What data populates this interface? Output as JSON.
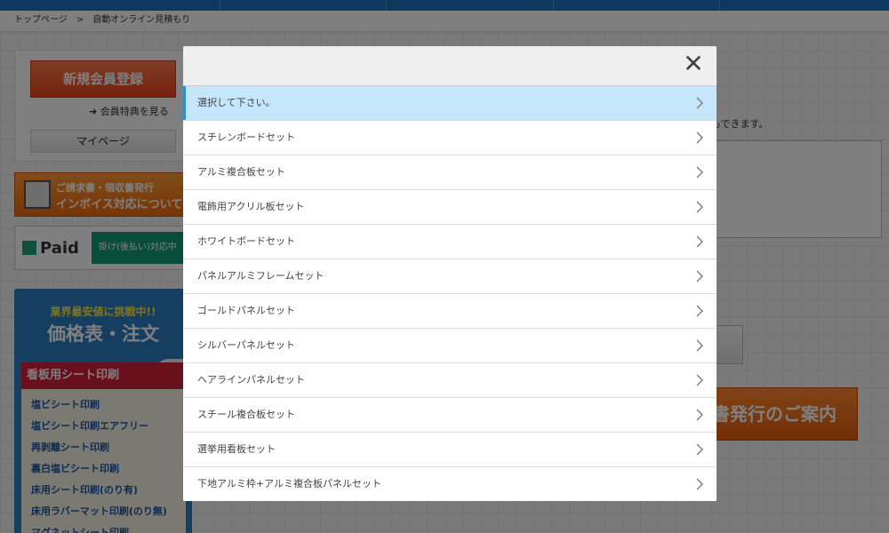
{
  "breadcrumb": {
    "home": "トップページ",
    "separator": ">",
    "current": "自動オンライン見積もり"
  },
  "sidebar": {
    "register_button": "新規会員登録",
    "benefit_link": "会員特典を見る",
    "mypage_button": "マイページ",
    "invoice_banner": {
      "line1": "ご請求書・領収書発行",
      "line2": "インボイス対応について"
    },
    "paid_banner": {
      "logo": "Paid",
      "tag": "掛け(後払い)対応中"
    },
    "price_panel": {
      "subtitle": "業界最安値に挑戦中!!",
      "title": "価格表・注文",
      "category": "看板用シート印刷",
      "items": [
        "塩ビシート印刷",
        "塩ビシート印刷エアフリー",
        "再剥離シート印刷",
        "裏白塩ビシート印刷",
        "床用シート印刷(のり有)",
        "床用ラバーマット印刷(のり無)",
        "マグネットシート印刷"
      ]
    }
  },
  "main": {
    "note_fragment": "もできます。",
    "banner_fragment": "書発行のご案内"
  },
  "modal": {
    "close_label": "✕",
    "options": [
      "選択して下さい。",
      "スチレンボードセット",
      "アルミ複合板セット",
      "電飾用アクリル板セット",
      "ホワイトボードセット",
      "パネルアルミフレームセット",
      "ゴールドパネルセット",
      "シルバーパネルセット",
      "ヘアラインパネルセット",
      "スチール複合板セット",
      "選挙用看板セット",
      "下地アルミ枠+アルミ複合板パネルセット"
    ],
    "selected_index": 0
  },
  "colors": {
    "accent_blue": "#2a8fd6",
    "selected_bg": "#c6e6fb",
    "topbar": "#1a72bd"
  }
}
